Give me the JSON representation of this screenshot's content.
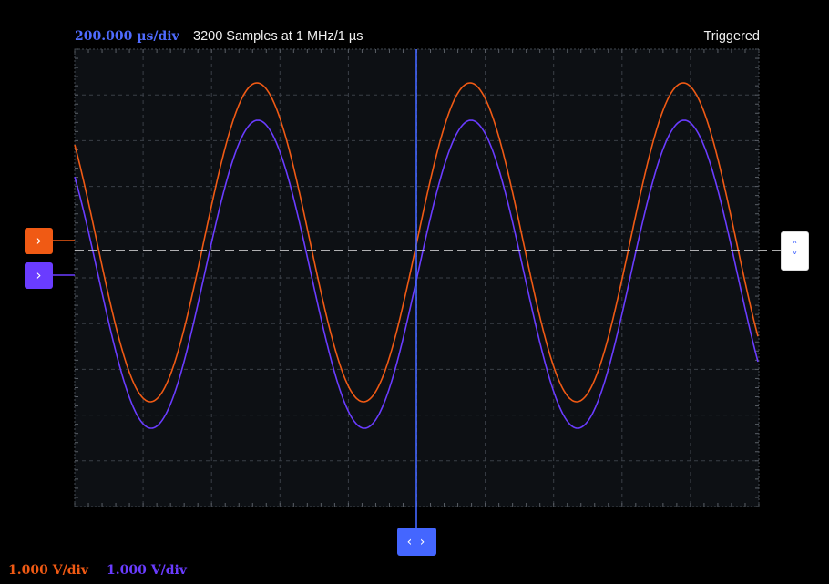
{
  "header": {
    "timebase": "200.000 µs/div",
    "samples": "3200 Samples at 1 MHz/1 µs",
    "trigger_status": "Triggered"
  },
  "footer": {
    "ch1_scale": "1.000 V/div",
    "ch2_scale": "1.000 V/div"
  },
  "colors": {
    "ch1": "#f05a14",
    "ch2": "#6a3cff",
    "timebase_text": "#4f6bff",
    "marker": "#4466ff",
    "grid": "#3a3f47",
    "plot_bg": "#0d1014"
  },
  "icons": {
    "ch1_handle": "chevron-right-icon",
    "ch2_handle": "chevron-right-icon",
    "trigger_handle": "chevron-up-down-icon",
    "time_handle": "chevron-left-right-icon"
  },
  "handles": {
    "ch1_glyph": "›",
    "ch2_glyph": "›",
    "trig_up_glyph": "˄",
    "trig_down_glyph": "˅",
    "time_glyph": "‹ ›"
  }
}
